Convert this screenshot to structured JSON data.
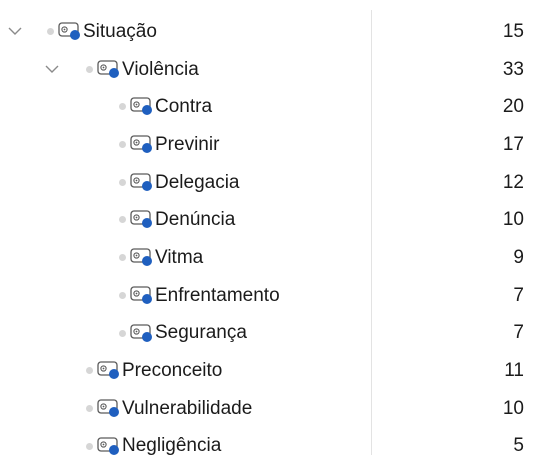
{
  "tree": {
    "rows": [
      {
        "label": "Situação",
        "count": "15",
        "level": 0,
        "expandable": true,
        "expanded": true
      },
      {
        "label": "Violência",
        "count": "33",
        "level": 1,
        "expandable": true,
        "expanded": true
      },
      {
        "label": "Contra",
        "count": "20",
        "level": 2,
        "expandable": false
      },
      {
        "label": "Previnir",
        "count": "17",
        "level": 2,
        "expandable": false
      },
      {
        "label": "Delegacia",
        "count": "12",
        "level": 2,
        "expandable": false
      },
      {
        "label": "Denúncia",
        "count": "10",
        "level": 2,
        "expandable": false
      },
      {
        "label": "Vitma",
        "count": "9",
        "level": 2,
        "expandable": false
      },
      {
        "label": "Enfrentamento",
        "count": "7",
        "level": 2,
        "expandable": false
      },
      {
        "label": "Segurança",
        "count": "7",
        "level": 2,
        "expandable": false
      },
      {
        "label": "Preconceito",
        "count": "11",
        "level": 1,
        "expandable": false
      },
      {
        "label": "Vulnerabilidade",
        "count": "10",
        "level": 1,
        "expandable": false
      },
      {
        "label": "Negligência",
        "count": "5",
        "level": 1,
        "expandable": false
      }
    ]
  },
  "icons": {
    "expand": "chevron-down-icon",
    "bullet": "dot-icon",
    "code": "code-node-icon"
  },
  "colors": {
    "accent": "#1f5fbf",
    "bullet": "#d6d6d6",
    "icon_outline": "#5a5a5a"
  }
}
